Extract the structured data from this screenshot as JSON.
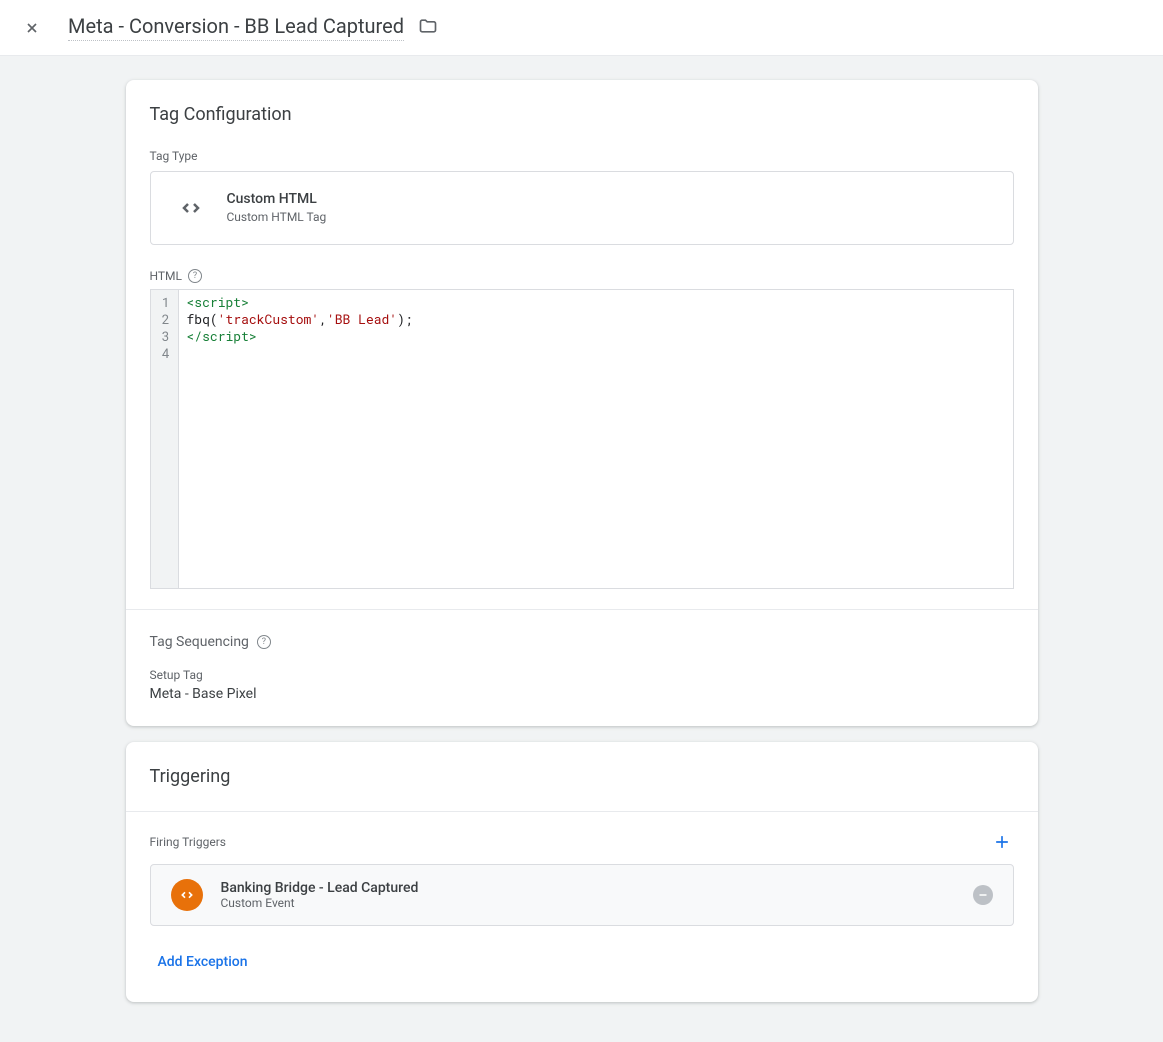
{
  "header": {
    "title": "Meta - Conversion - BB Lead Captured"
  },
  "tagConfig": {
    "cardTitle": "Tag Configuration",
    "tagTypeLabel": "Tag Type",
    "tagTypeName": "Custom HTML",
    "tagTypeSub": "Custom HTML Tag",
    "htmlLabel": "HTML",
    "code": {
      "lineNumbers": [
        "1",
        "2",
        "3",
        "4"
      ],
      "line1_open": "<script>",
      "line2_fn": "fbq",
      "line2_p1": "(",
      "line2_s1": "'trackCustom'",
      "line2_c": ",",
      "line2_s2": "'BB Lead'",
      "line2_p2": ");",
      "line3_close": "</script>"
    },
    "sequencingLabel": "Tag Sequencing",
    "setupTagLabel": "Setup Tag",
    "setupTagValue": "Meta - Base Pixel"
  },
  "triggering": {
    "cardTitle": "Triggering",
    "firingLabel": "Firing Triggers",
    "trigger": {
      "name": "Banking Bridge - Lead Captured",
      "type": "Custom Event"
    },
    "addExceptionLabel": "Add Exception"
  }
}
